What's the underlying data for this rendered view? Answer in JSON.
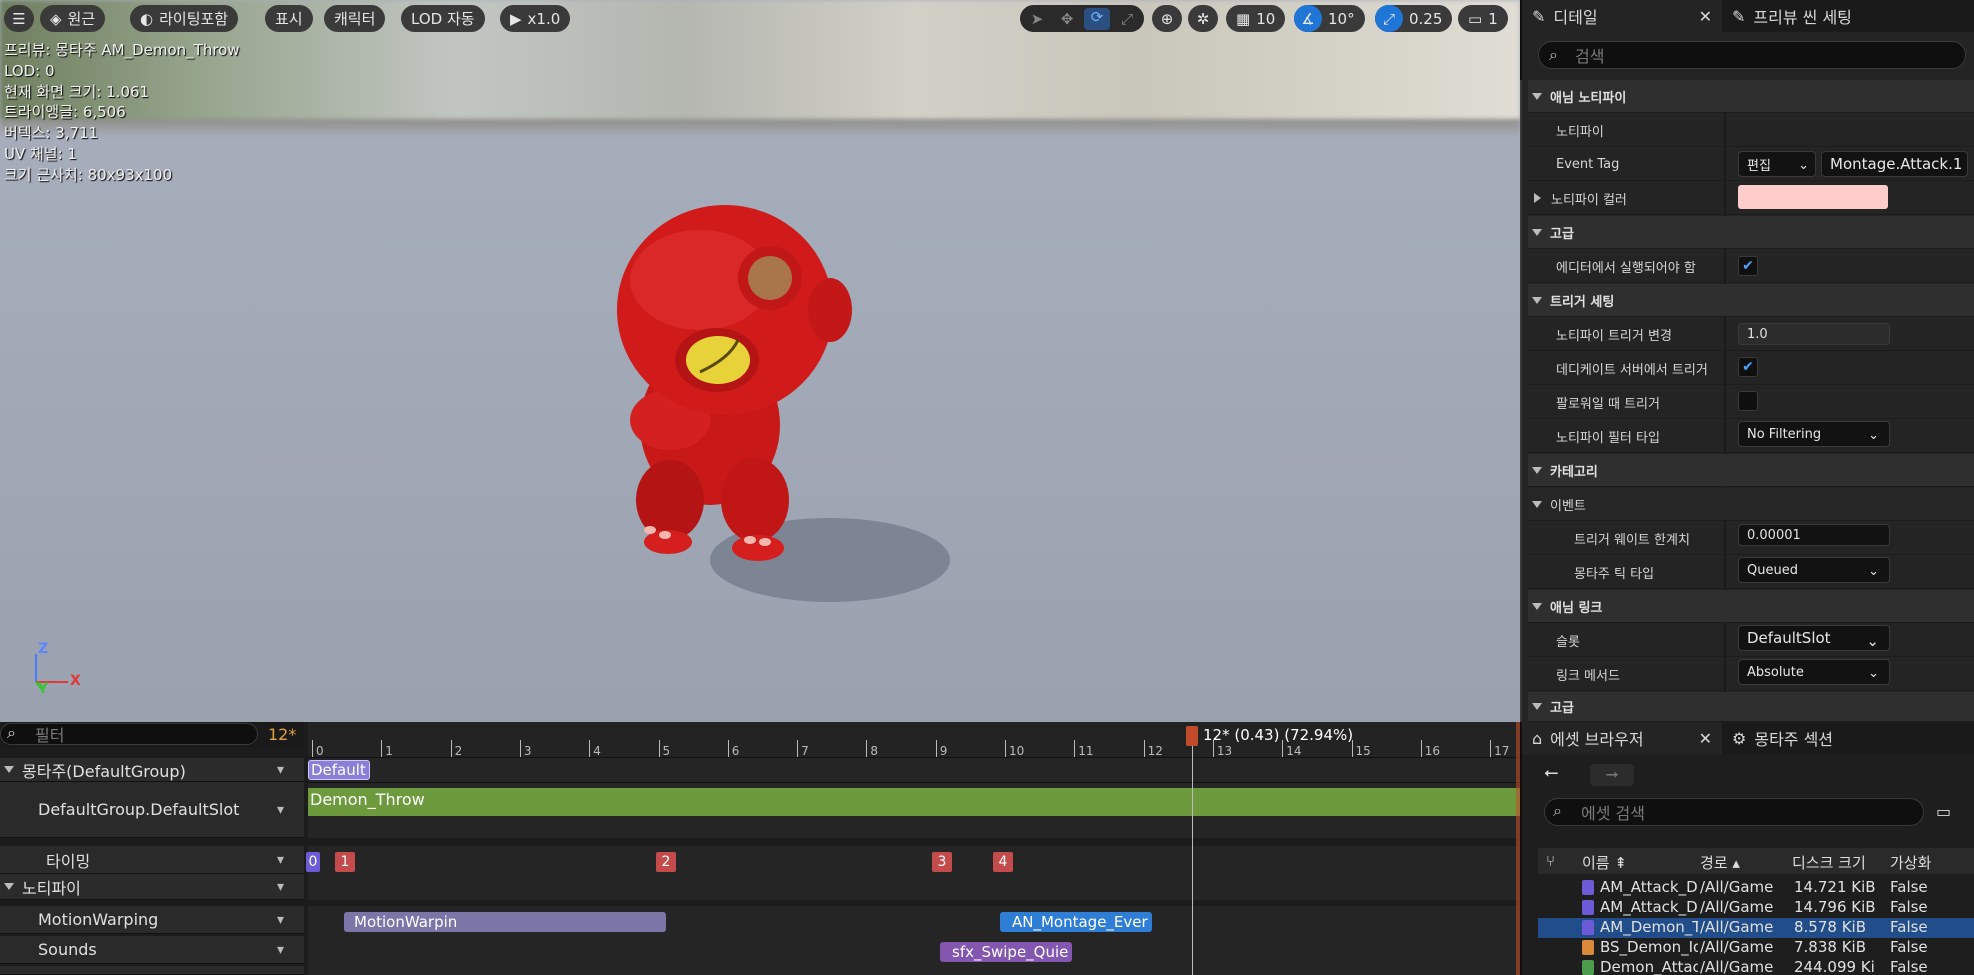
{
  "viewport": {
    "toolbar": {
      "menu_icon": "hamburger-icon",
      "perspective_label": "원근",
      "lighting_label": "라이팅포함",
      "show_label": "표시",
      "character_label": "캐릭터",
      "lod_label": "LOD 자동",
      "play_speed_label": "x1.0",
      "grid_value": "10",
      "angle_value": "10°",
      "scale_value": "0.25",
      "camera_value": "1"
    },
    "info": {
      "preview": "프리뷰: 몽타주 AM_Demon_Throw",
      "lod": "LOD: 0",
      "screen_size": "현재 화면 크기: 1.061",
      "triangles": "트라이앵글: 6,506",
      "vertices": "버텍스: 3,711",
      "uv_channels": "UV 채널: 1",
      "approx_size": "크기 근사치: 80x93x100"
    },
    "axes": {
      "z": "Z",
      "y": "Y",
      "x": "X"
    }
  },
  "details": {
    "tab_details": "디테일",
    "tab_preview": "프리뷰 씬 세팅",
    "search_placeholder": "검색",
    "rows": {
      "anim_notify": "애님 노티파이",
      "notify": "노티파이",
      "event_tag": "Event Tag",
      "edit_label": "편집",
      "event_tag_value": "Montage.Attack.1",
      "notify_color": "노티파이 컬러",
      "advanced": "고급",
      "run_in_editor": "에디터에서 실행되어야 함",
      "trigger_settings": "트리거 세팅",
      "trigger_chance": "노티파이 트리거 변경",
      "trigger_chance_value": "1.0",
      "trigger_dedicated": "데디케이트 서버에서 트리거",
      "trigger_follower": "팔로워일 때 트리거",
      "filter_type": "노티파이 필터 타입",
      "filter_type_value": "No Filtering",
      "category": "카테고리",
      "event": "이벤트",
      "weight_threshold": "트리거 웨이트 한계치",
      "weight_threshold_value": "0.00001",
      "tick_type": "몽타주 틱 타입",
      "tick_type_value": "Queued",
      "anim_link": "애님 링크",
      "slot": "슬롯",
      "slot_value": "DefaultSlot",
      "link_method": "링크 메서드",
      "link_method_value": "Absolute",
      "advanced2": "고급"
    },
    "colors": {
      "notify_color": "#ffcccc",
      "accent": "#1f76d6"
    }
  },
  "timeline": {
    "filter_placeholder": "필터",
    "current_frame": "12*",
    "playhead_label": "12* (0.43) (72.94%)",
    "ruler_ticks": [
      "0",
      "1",
      "2",
      "3",
      "4",
      "5",
      "6",
      "7",
      "8",
      "9",
      "10",
      "11",
      "12",
      "13",
      "14",
      "15",
      "16",
      "17"
    ],
    "tracks": {
      "montage_group": "몽타주(DefaultGroup)",
      "slot": "DefaultGroup.DefaultSlot",
      "timing": "타이밍",
      "notifies": "노티파이",
      "motion_warping": "MotionWarping",
      "sounds": "Sounds"
    },
    "default_section": "Default",
    "anim_segment": "Demon_Throw",
    "timing_markers": [
      "0",
      "1",
      "2",
      "3",
      "4"
    ],
    "notify_motion_warping": "MotionWarpin",
    "notify_event": "AN_Montage_Ever",
    "notify_sfx": "sfx_Swipe_Quie"
  },
  "assets": {
    "tab_asset_browser": "에셋 브라우저",
    "tab_montage_sections": "몽타주 섹션",
    "search_placeholder": "에셋 검색",
    "columns": {
      "name": "이름",
      "path": "경로",
      "disk_size": "디스크 크기",
      "virtual": "가상화"
    },
    "rows": [
      {
        "name": "AM_Attack_Demo",
        "path": "/All/Game",
        "size": "14.721 KiB",
        "virtual": "False",
        "color": "#6b5bd6"
      },
      {
        "name": "AM_Attack_Demo",
        "path": "/All/Game",
        "size": "14.796 KiB",
        "virtual": "False",
        "color": "#6b5bd6"
      },
      {
        "name": "AM_Demon_Thro",
        "path": "/All/Game",
        "size": "8.578 KiB",
        "virtual": "False",
        "color": "#6b5bd6"
      },
      {
        "name": "BS_Demon_IdleR",
        "path": "/All/Game",
        "size": "7.838 KiB",
        "virtual": "False",
        "color": "#d98a3a"
      },
      {
        "name": "Demon_Attack_L",
        "path": "/All/Game",
        "size": "244.099 Ki",
        "virtual": "False",
        "color": "#4c9a4c"
      }
    ]
  }
}
